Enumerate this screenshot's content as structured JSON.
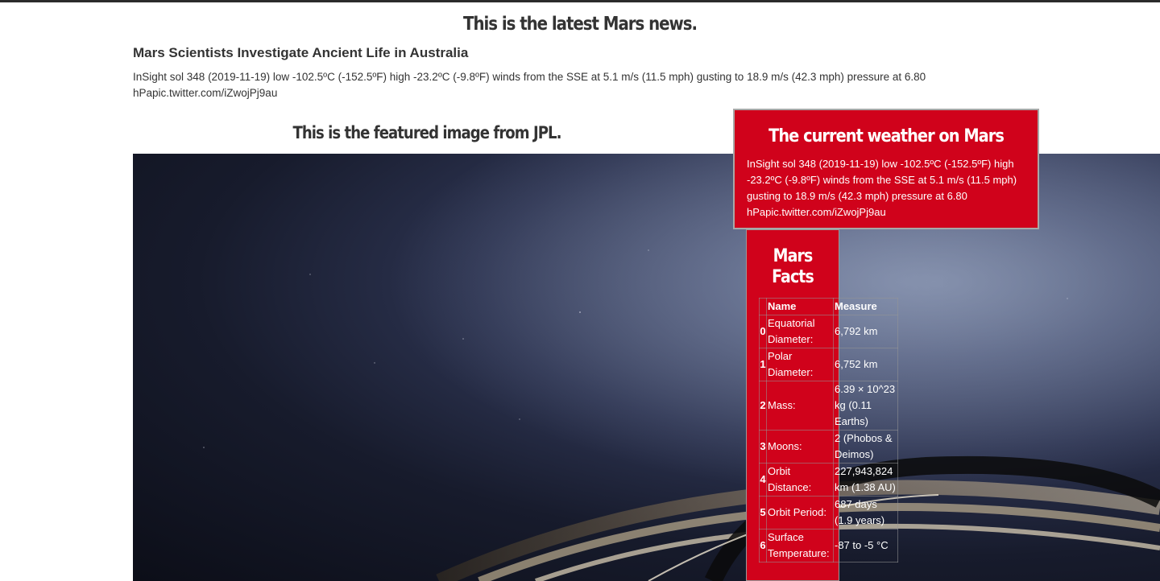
{
  "page": {
    "heading": "This is the latest Mars news."
  },
  "news": {
    "title": "Mars Scientists Investigate Ancient Life in Australia",
    "body": "InSight sol 348 (2019-11-19) low -102.5ºC (-152.5ºF) high -23.2ºC (-9.8ºF) winds from the SSE at 5.1 m/s (11.5 mph) gusting to 18.9 m/s (42.3 mph) pressure at 6.80 hPapic.twitter.com/iZwojPj9au"
  },
  "featured": {
    "heading": "This is the featured image from JPL."
  },
  "weather": {
    "heading": "The current weather on Mars",
    "text": "InSight sol 348 (2019-11-19) low -102.5ºC (-152.5ºF) high -23.2ºC (-9.8ºF) winds from the SSE at 5.1 m/s (11.5 mph) gusting to 18.9 m/s (42.3 mph) pressure at 6.80 hPapic.twitter.com/iZwojPj9au"
  },
  "facts": {
    "heading_line1": "Mars",
    "heading_line2": "Facts",
    "columns": [
      "Name",
      "Measure"
    ],
    "rows": [
      {
        "index": "0",
        "name": "Equatorial Diameter:",
        "measure": "6,792 km"
      },
      {
        "index": "1",
        "name": "Polar Diameter:",
        "measure": "6,752 km"
      },
      {
        "index": "2",
        "name": "Mass:",
        "measure": "6.39 × 10^23 kg (0.11 Earths)"
      },
      {
        "index": "3",
        "name": "Moons:",
        "measure": "2 (Phobos & Deimos)"
      },
      {
        "index": "4",
        "name": "Orbit Distance:",
        "measure": "227,943,824 km (1.38 AU)"
      },
      {
        "index": "5",
        "name": "Orbit Period:",
        "measure": "687 days (1.9 years)"
      },
      {
        "index": "6",
        "name": "Surface Temperature:",
        "measure": "-87 to -5 °C"
      }
    ]
  },
  "colors": {
    "accent_red": "#d0021b",
    "text": "#333333"
  }
}
